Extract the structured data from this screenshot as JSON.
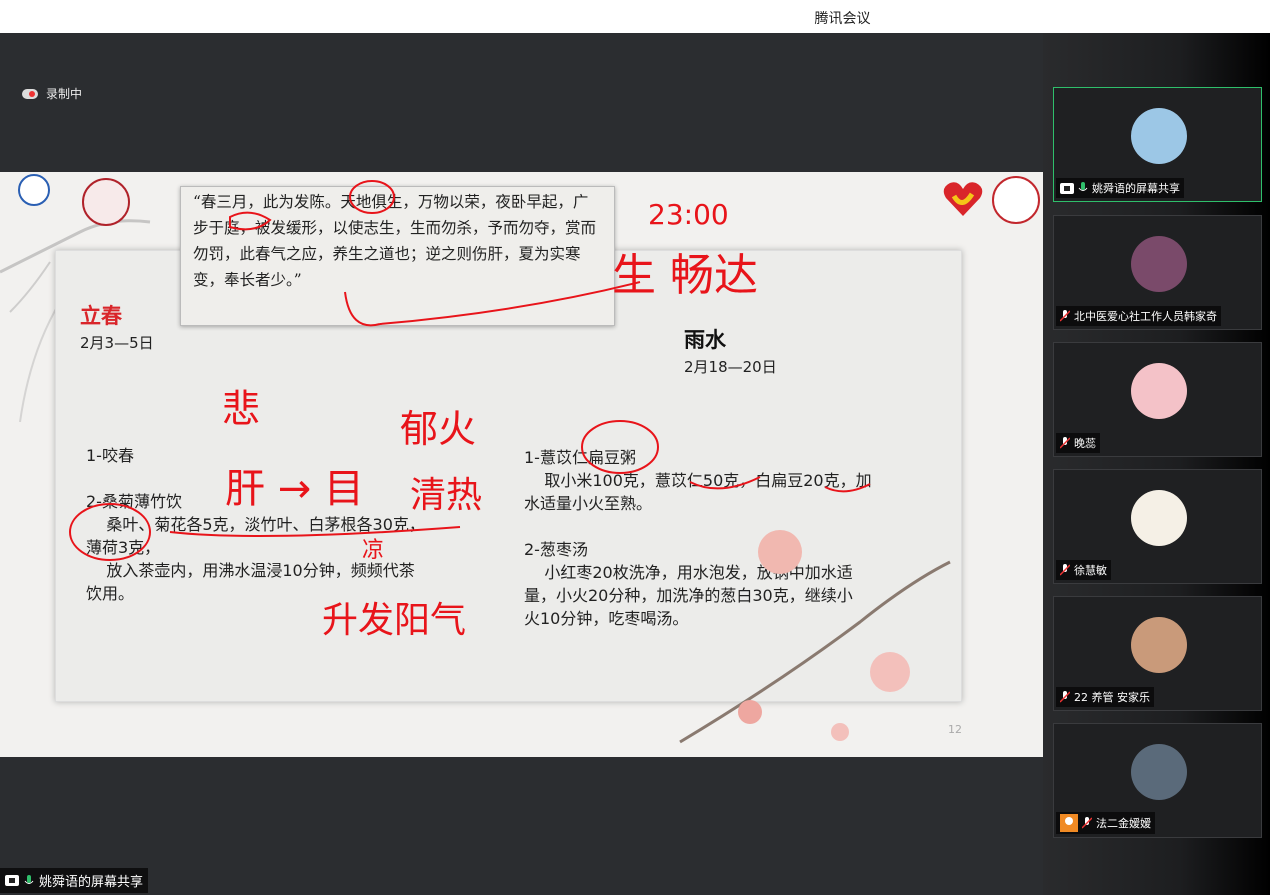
{
  "window": {
    "title": "腾讯会议"
  },
  "recording": {
    "label": "录制中"
  },
  "slide": {
    "quote": "“春三月，此为发陈。天地俱生，万物以荣，夜卧早起，广步于庭，被发缓形，以使志生，生而勿杀，予而勿夺，赏而勿罚，此春气之应，养生之道也；逆之则伤肝，夏为实寒变，奉长者少。”",
    "section1": {
      "title": "立春",
      "date": "2月3—5日"
    },
    "section2": {
      "title": "雨水",
      "date": "2月18—20日"
    },
    "left_column": "1-咬春\n\n2-桑菊薄竹饮\n    桑叶、菊花各5克，淡竹叶、白茅根各30克，\n薄荷3克，\n    放入茶壶内，用沸水温浸10分钟，频频代茶\n饮用。",
    "right_column": "1-薏苡仁扁豆粥\n    取小米100克，薏苡仁50克，白扁豆20克，加\n水适量小火至熟。\n\n2-葱枣汤\n    小红枣20枚洗净，用水泡发，放锅中加水适\n量，小火20分种，加洗净的葱白30克，继续小\n火10分钟，吃枣喝汤。",
    "page_number": "12",
    "annotations": {
      "a1": "23:00",
      "a2": "生 畅达",
      "a3": "悲",
      "a4": "郁火",
      "a5": "肝 → 目",
      "a6": "清热",
      "a7": "凉",
      "a8": "升发阳气"
    },
    "annotation_color": "#e8141a"
  },
  "participants": [
    {
      "name": "姚舜语的屏幕共享",
      "mic": "on",
      "share": true,
      "active": true,
      "avatar_color": "#9cc7e6"
    },
    {
      "name": "北中医爱心社工作人员韩家奇",
      "mic": "muted",
      "share": false,
      "active": false,
      "avatar_color": "#7a4a6a"
    },
    {
      "name": "晚蕊",
      "mic": "muted",
      "share": false,
      "active": false,
      "avatar_color": "#f4c2c8"
    },
    {
      "name": "徐慧敏",
      "mic": "muted",
      "share": false,
      "active": false,
      "avatar_color": "#f5f0e6"
    },
    {
      "name": "22 养管 安家乐",
      "mic": "muted",
      "share": false,
      "active": false,
      "avatar_color": "#c99a7a"
    },
    {
      "name": "法二金嫒嫒",
      "mic": "muted",
      "share": false,
      "active": false,
      "user_badge": true,
      "avatar_color": "#5a6a7a"
    }
  ],
  "bottom_status": {
    "label": "姚舜语的屏幕共享"
  },
  "colors": {
    "mic_on": "#2fbf6b",
    "active_border": "#2fbf6b"
  }
}
